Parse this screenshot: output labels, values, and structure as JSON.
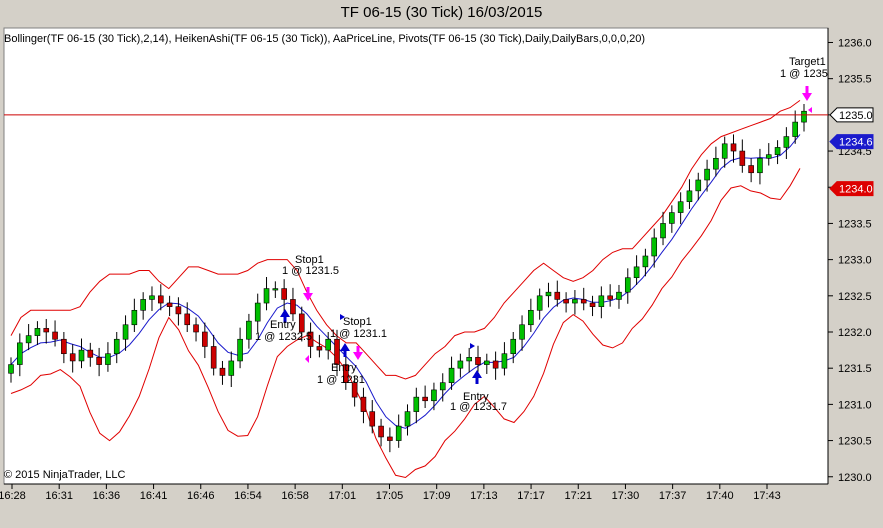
{
  "window": {
    "title": "TF 06-15 (30 Tick)  16/03/2015",
    "indicators": "Bollinger(TF 06-15 (30 Tick),2,14), HeikenAshi(TF 06-15 (30 Tick)), AaPriceLine, Pivots(TF 06-15 (30 Tick),Daily,DailyBars,0,0,0,20)",
    "copyright": "© 2015 NinjaTrader, LLC"
  },
  "colors": {
    "background": "#d4d0c8",
    "plot_background": "#ffffff",
    "bollinger_band": "#e00000",
    "bollinger_mid": "#1a1acc",
    "up_candle": "#00c000",
    "down_candle": "#cc0000",
    "price_line": "#cc0000",
    "buy_arrow": "#0000cc",
    "sell_arrow": "#ff00ff"
  },
  "chart_data": {
    "type": "candlestick",
    "title": "TF 06-15 (30 Tick)  16/03/2015",
    "ylim": [
      1229.9,
      1236.2
    ],
    "y_ticks": [
      "1236.0",
      "1235.5",
      "1235.0",
      "1234.5",
      "1234.0",
      "1233.5",
      "1233.0",
      "1232.5",
      "1232.0",
      "1231.5",
      "1231.0",
      "1230.5",
      "1230.0"
    ],
    "x_ticks": [
      "16:28",
      "16:31",
      "16:36",
      "16:41",
      "16:46",
      "16:54",
      "16:58",
      "17:01",
      "17:05",
      "17:09",
      "17:13",
      "17:17",
      "17:21",
      "17:30",
      "17:37",
      "17:40",
      "17:43"
    ],
    "price_labels": [
      {
        "label": "1235.0",
        "value": 1235.0,
        "style": "current"
      },
      {
        "label": "1234.6",
        "value": 1234.63,
        "style": "blue"
      },
      {
        "label": "1234.0",
        "value": 1233.98,
        "style": "red"
      }
    ],
    "current_price": 1235.0,
    "closes": [
      1231.55,
      1231.85,
      1231.95,
      1232.05,
      1232.0,
      1231.9,
      1231.7,
      1231.6,
      1231.75,
      1231.65,
      1231.55,
      1231.7,
      1231.9,
      1232.1,
      1232.3,
      1232.45,
      1232.5,
      1232.4,
      1232.35,
      1232.25,
      1232.1,
      1232.0,
      1231.8,
      1231.5,
      1231.4,
      1231.6,
      1231.9,
      1232.15,
      1232.4,
      1232.6,
      1232.6,
      1232.45,
      1232.25,
      1232.0,
      1231.8,
      1231.75,
      1231.9,
      1231.55,
      1231.3,
      1231.1,
      1230.9,
      1230.7,
      1230.55,
      1230.5,
      1230.7,
      1230.9,
      1231.1,
      1231.05,
      1231.2,
      1231.3,
      1231.5,
      1231.6,
      1231.65,
      1231.55,
      1231.6,
      1231.5,
      1231.7,
      1231.9,
      1232.1,
      1232.3,
      1232.5,
      1232.55,
      1232.45,
      1232.4,
      1232.45,
      1232.4,
      1232.35,
      1232.5,
      1232.45,
      1232.55,
      1232.75,
      1232.9,
      1233.05,
      1233.3,
      1233.5,
      1233.65,
      1233.8,
      1233.95,
      1234.1,
      1234.25,
      1234.4,
      1234.6,
      1234.5,
      1234.3,
      1234.2,
      1234.4,
      1234.45,
      1234.55,
      1234.7,
      1234.9,
      1235.05
    ],
    "bollinger_upper": [
      1231.95,
      1232.2,
      1232.3,
      1232.3,
      1232.3,
      1232.3,
      1232.3,
      1232.35,
      1232.55,
      1232.7,
      1232.8,
      1232.8,
      1232.8,
      1232.85,
      1232.85,
      1232.7,
      1232.6,
      1232.75,
      1232.9,
      1232.9,
      1232.85,
      1232.8,
      1232.8,
      1232.8,
      1232.85,
      1232.95,
      1233.0,
      1233.0,
      1233.0,
      1232.85,
      1232.55,
      1232.3,
      1232.1,
      1231.95,
      1231.85,
      1231.85,
      1231.7,
      1231.55,
      1231.4,
      1231.4,
      1231.35,
      1231.4,
      1231.55,
      1231.7,
      1231.8,
      1231.95,
      1232.0,
      1232.0,
      1232.05,
      1232.2,
      1232.4,
      1232.55,
      1232.7,
      1232.85,
      1232.95,
      1232.85,
      1232.75,
      1232.7,
      1232.75,
      1232.85,
      1233.0,
      1233.1,
      1233.15,
      1233.15,
      1233.3,
      1233.45,
      1233.6,
      1233.8,
      1234.0,
      1234.25,
      1234.45,
      1234.6,
      1234.7,
      1234.75,
      1234.8,
      1234.85,
      1234.9,
      1234.95,
      1235.05,
      1235.1,
      1235.2
    ]
  }
}
